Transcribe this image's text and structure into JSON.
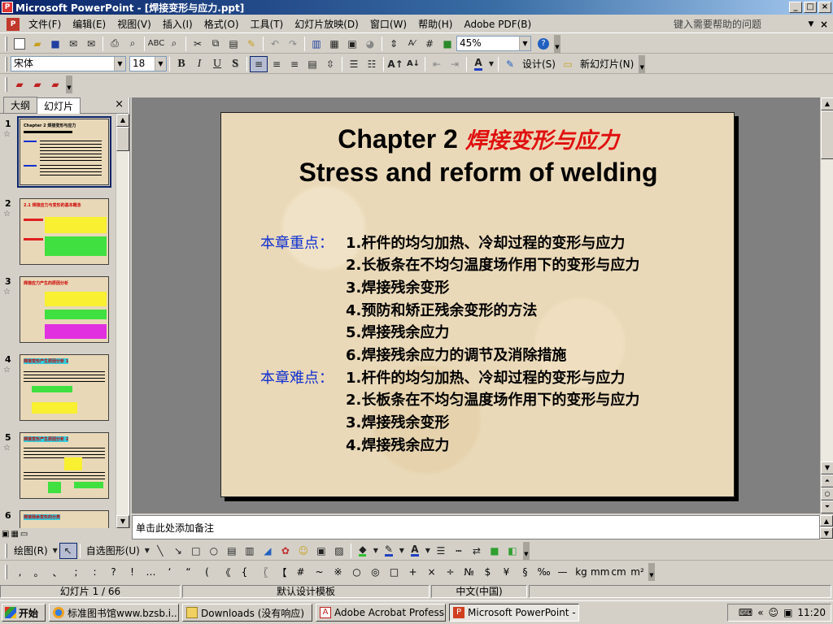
{
  "window": {
    "title": "Microsoft PowerPoint - [焊接变形与应力.ppt]"
  },
  "menu": {
    "items": [
      "文件(F)",
      "编辑(E)",
      "视图(V)",
      "插入(I)",
      "格式(O)",
      "工具(T)",
      "幻灯片放映(D)",
      "窗口(W)",
      "帮助(H)",
      "Adobe PDF(B)"
    ],
    "help_placeholder": "键入需要帮助的问题"
  },
  "toolbar": {
    "zoom": "45%",
    "font_name": "宋体",
    "font_size": "18",
    "bold": "B",
    "italic": "I",
    "underline": "U",
    "shadow": "S",
    "design_label": "设计(S)",
    "new_slide_label": "新幻灯片(N)"
  },
  "panes": {
    "tab_outline": "大纲",
    "tab_slides": "幻灯片",
    "close": "×"
  },
  "thumbnails": [
    {
      "num": "1",
      "title": "Chapter 2 焊接变形与应力"
    },
    {
      "num": "2",
      "title": "2.1 焊接应力与变形的基本概念"
    },
    {
      "num": "3",
      "title": "焊接应力产生的原因分析"
    },
    {
      "num": "4",
      "title": "焊接变形产生原因分析 1"
    },
    {
      "num": "5",
      "title": "焊接变形产生原因分析 2"
    },
    {
      "num": "6",
      "title": "焊接残余变形的分类"
    }
  ],
  "slide": {
    "title_en": "Chapter 2 ",
    "title_cn": "焊接变形与应力",
    "subtitle": "Stress and reform of welding",
    "key_label": "本章重点：",
    "key_points": [
      "1.杆件的均匀加热、冷却过程的变形与应力",
      "2.长板条在不均匀温度场作用下的变形与应力",
      "3.焊接残余变形",
      "4.预防和矫正残余变形的方法",
      "5.焊接残余应力",
      "6.焊接残余应力的调节及消除措施"
    ],
    "difficult_label": "本章难点：",
    "difficult_points": [
      "1.杆件的均匀加热、冷却过程的变形与应力",
      "2.长板条在不均匀温度场作用下的变形与应力",
      "3.焊接残余变形",
      "4.焊接残余应力"
    ]
  },
  "notes": {
    "placeholder": "单击此处添加备注"
  },
  "drawbar": {
    "draw_label": "绘图(R)",
    "autoshape_label": "自选图形(U)"
  },
  "symbols": [
    ",",
    "。",
    "、",
    ";",
    ":",
    "?",
    "!",
    "…",
    "‘",
    "“",
    "(",
    "《",
    "{",
    "〖",
    "【",
    "#",
    "~",
    "※",
    "○",
    "◎",
    "□",
    "+",
    "×",
    "÷",
    "№",
    "$",
    "¥",
    "§",
    "‰",
    "—",
    "kg",
    "mm",
    "cm",
    "m²"
  ],
  "status": {
    "slide_pos": "幻灯片 1 / 66",
    "template": "默认设计模板",
    "language": "中文(中国)"
  },
  "taskbar": {
    "start": "开始",
    "items": [
      "标准图书馆www.bzsb.i...",
      "Downloads (没有响应)",
      "Adobe Acrobat Professio...",
      "Microsoft PowerPoint - [..."
    ],
    "clock": "11:20"
  }
}
